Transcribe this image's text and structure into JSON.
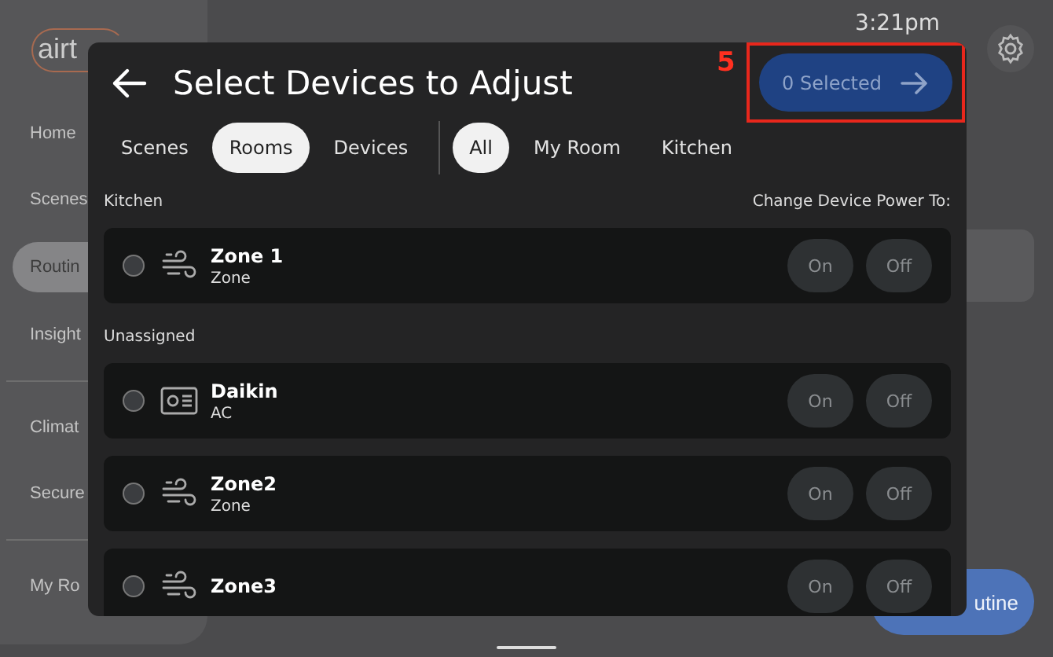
{
  "background": {
    "logo": "airt",
    "time": "3:21pm",
    "sidebar": [
      {
        "label": "Home",
        "selected": false
      },
      {
        "label": "Scenes",
        "selected": false
      },
      {
        "label": "Routin",
        "selected": true
      },
      {
        "label": "Insight",
        "selected": false,
        "divider_after": true
      },
      {
        "label": "Climat",
        "selected": false
      },
      {
        "label": "Secure",
        "selected": false,
        "divider_after": true
      },
      {
        "label": "My Ro",
        "selected": false
      }
    ],
    "action_button": "utine"
  },
  "dialog": {
    "title": "Select Devices to Adjust",
    "selected_button": "0 Selected",
    "annotation": "5",
    "type_tabs": [
      {
        "label": "Scenes",
        "selected": false
      },
      {
        "label": "Rooms",
        "selected": true
      },
      {
        "label": "Devices",
        "selected": false
      }
    ],
    "room_tabs": [
      {
        "label": "All",
        "selected": true
      },
      {
        "label": "My Room",
        "selected": false
      },
      {
        "label": "Kitchen",
        "selected": false
      }
    ],
    "power_heading": "Change Device Power To:",
    "groups": [
      {
        "name": "Kitchen",
        "devices": [
          {
            "name": "Zone 1",
            "type": "Zone",
            "kind": "zone",
            "checked": false,
            "on_label": "On",
            "off_label": "Off"
          }
        ]
      },
      {
        "name": "Unassigned",
        "devices": [
          {
            "name": "Daikin",
            "type": "AC",
            "kind": "ac",
            "checked": false,
            "on_label": "On",
            "off_label": "Off"
          },
          {
            "name": "Zone2",
            "type": "Zone",
            "kind": "zone",
            "checked": false,
            "on_label": "On",
            "off_label": "Off"
          },
          {
            "name": "Zone3",
            "kind": "zone",
            "checked": false,
            "on_label": "On",
            "off_label": "Off"
          }
        ]
      }
    ]
  }
}
